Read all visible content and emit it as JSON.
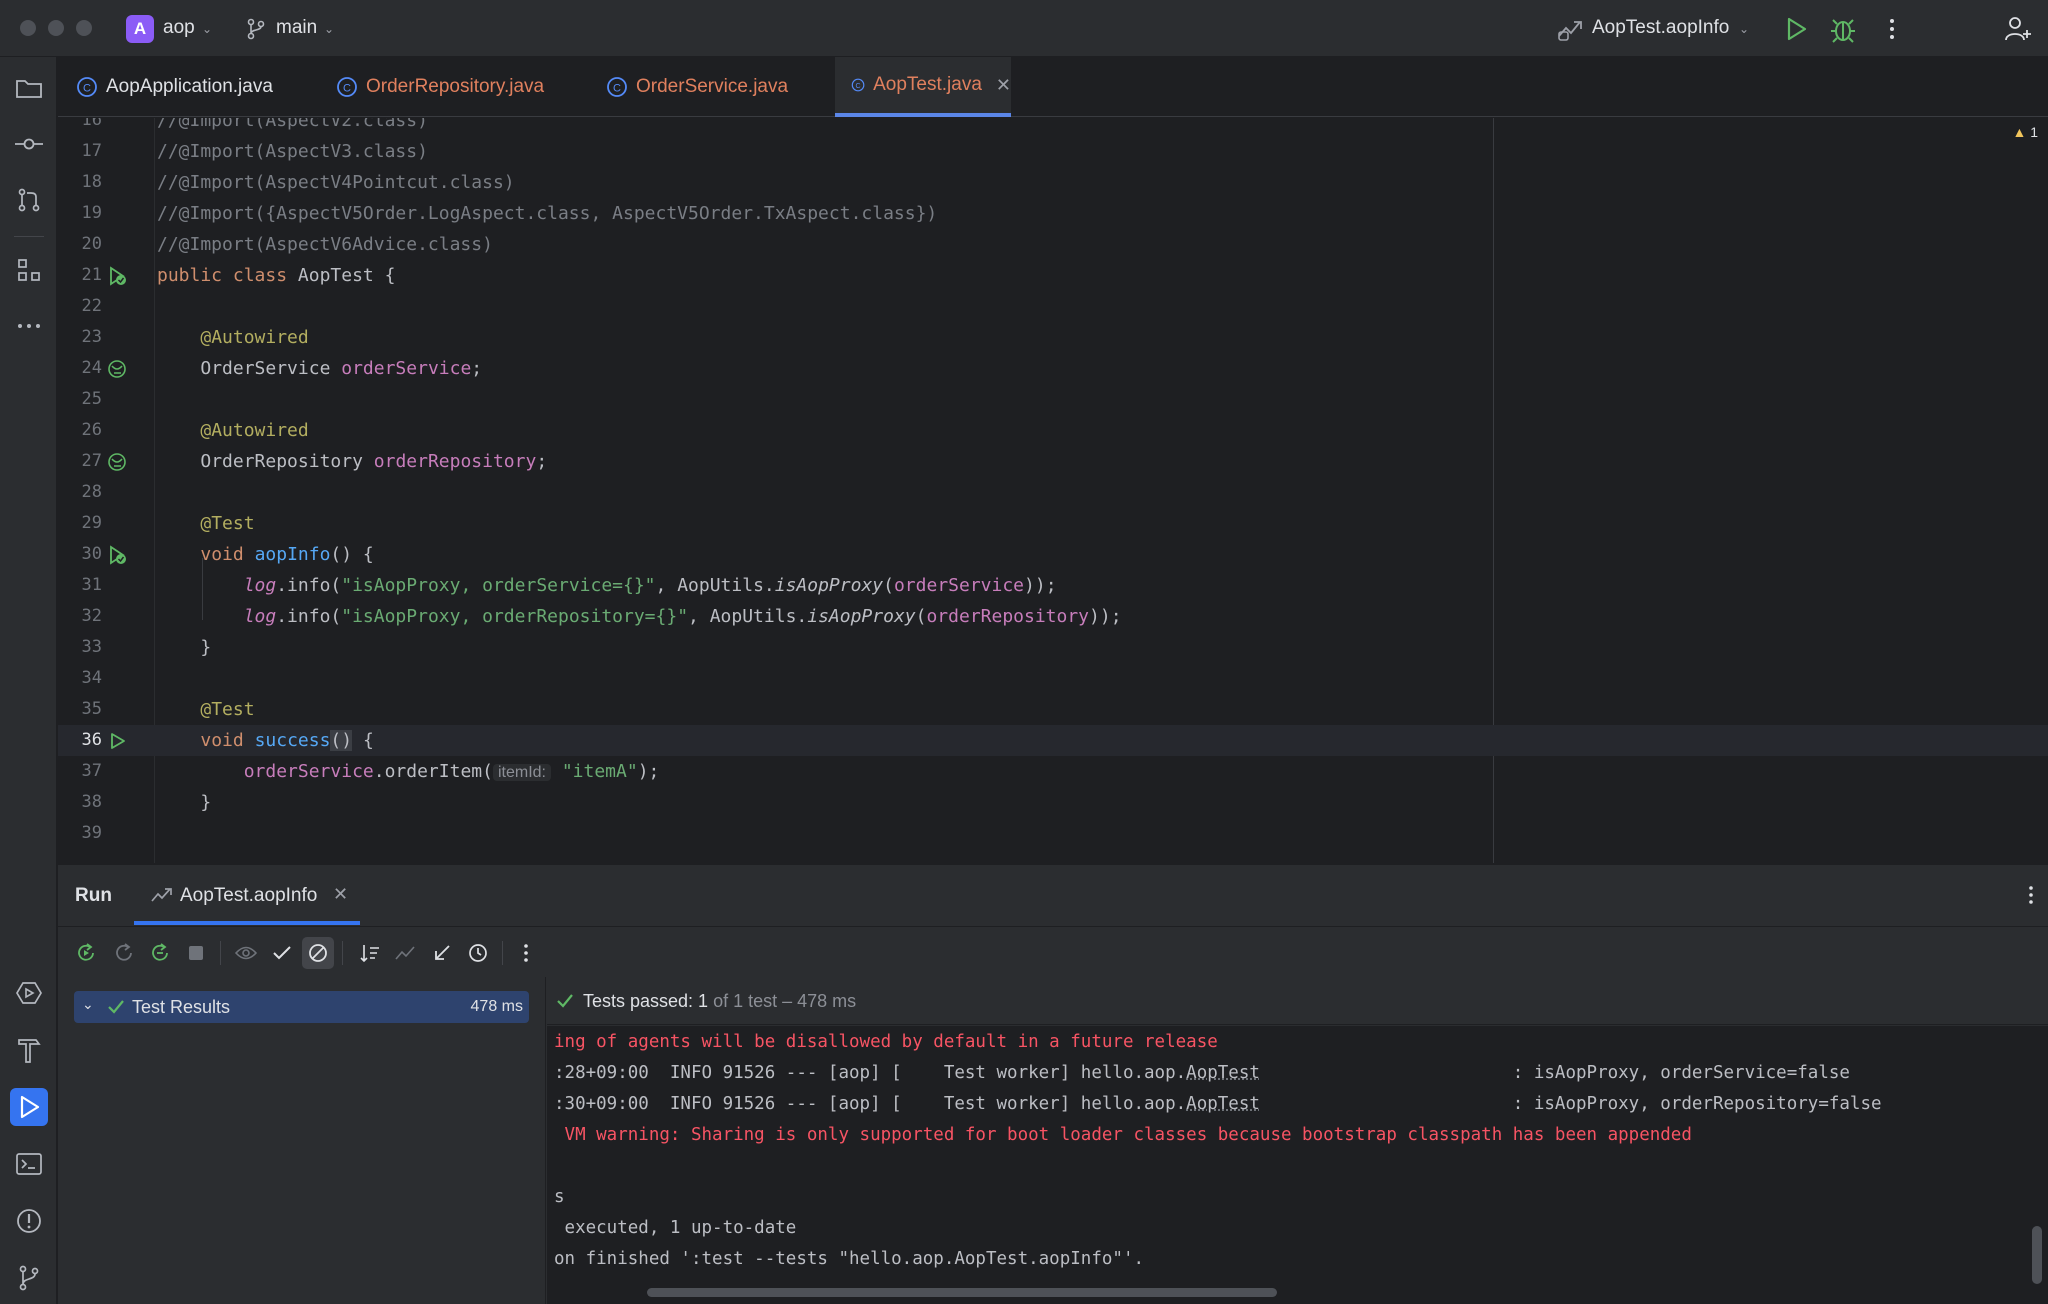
{
  "titlebar": {
    "project_badge": "A",
    "project_name": "aop",
    "branch": "main",
    "run_config": "AopTest.aopInfo"
  },
  "tabs": [
    {
      "label": "AopApplication.java",
      "color": "#dfe1e5"
    },
    {
      "label": "OrderRepository.java",
      "color": "#e0805e"
    },
    {
      "label": "OrderService.java",
      "color": "#e0805e"
    },
    {
      "label": "AopTest.java",
      "color": "#e0805e",
      "active": true
    }
  ],
  "editor": {
    "warning_count": "1",
    "lines": [
      {
        "n": "16",
        "text": "//@Import(AspectV2.class)"
      },
      {
        "n": "17",
        "text": "//@Import(AspectV3.class)"
      },
      {
        "n": "18",
        "text": "//@Import(AspectV4Pointcut.class)"
      },
      {
        "n": "19",
        "text": "//@Import({AspectV5Order.LogAspect.class, AspectV5Order.TxAspect.class})"
      },
      {
        "n": "20",
        "text": "//@Import(AspectV6Advice.class)"
      },
      {
        "n": "21",
        "kw1": "public",
        "kw2": "class",
        "name": "AopTest",
        "rest": " {"
      },
      {
        "n": "22"
      },
      {
        "n": "23",
        "ann": "@Autowired"
      },
      {
        "n": "24",
        "type": "OrderService",
        "field": "orderService",
        "rest": ";"
      },
      {
        "n": "25"
      },
      {
        "n": "26",
        "ann": "@Autowired"
      },
      {
        "n": "27",
        "type": "OrderRepository",
        "field": "orderRepository",
        "rest": ";"
      },
      {
        "n": "28"
      },
      {
        "n": "29",
        "ann": "@Test"
      },
      {
        "n": "30",
        "kw": "void",
        "fn": "aopInfo",
        "rest": "() {"
      },
      {
        "n": "31",
        "log": "log",
        "mid": ".info(",
        "str": "\"isAopProxy, orderService={}\"",
        "mid2": ", AopUtils.",
        "it": "isAopProxy",
        "p1": "(",
        "field": "orderService",
        "p2": "));"
      },
      {
        "n": "32",
        "log": "log",
        "mid": ".info(",
        "str": "\"isAopProxy, orderRepository={}\"",
        "mid2": ", AopUtils.",
        "it": "isAopProxy",
        "p1": "(",
        "field": "orderRepository",
        "p2": "));"
      },
      {
        "n": "33",
        "text": "}"
      },
      {
        "n": "34"
      },
      {
        "n": "35",
        "ann": "@Test"
      },
      {
        "n": "36",
        "kw": "void",
        "fn": "success",
        "rest": " {"
      },
      {
        "n": "37",
        "field": "orderService",
        "mid": ".orderItem(",
        "hint": "itemId:",
        "str": "\"itemA\"",
        "rest": ");"
      },
      {
        "n": "38",
        "text": "}"
      },
      {
        "n": "39"
      }
    ]
  },
  "run": {
    "title": "Run",
    "tab_label": "AopTest.aopInfo",
    "tree_label": "Test Results",
    "tree_time": "478 ms",
    "status_pass": "Tests passed: 1",
    "status_rest": " of 1 test – 478 ms",
    "console": [
      {
        "text": "ing of agents will be disallowed by default in a future release",
        "err": true
      },
      {
        "pre": ":28+09:00  INFO 91526 --- [aop] [    Test worker] hello.aop.",
        "cls": "AopTest",
        "post": "                        : isAopProxy, orderService=false"
      },
      {
        "pre": ":30+09:00  INFO 91526 --- [aop] [    Test worker] hello.aop.",
        "cls": "AopTest",
        "post": "                        : isAopProxy, orderRepository=false"
      },
      {
        "text": " VM warning: Sharing is only supported for boot loader classes because bootstrap classpath has been appended",
        "err": true
      },
      {
        "text": ""
      },
      {
        "text": "s"
      },
      {
        "text": " executed, 1 up-to-date"
      },
      {
        "text": "on finished ':test --tests \"hello.aop.AopTest.aopInfo\"'."
      }
    ]
  },
  "colors": {
    "accent": "#3574f0",
    "pass": "#5fb865",
    "error": "#f75464"
  }
}
